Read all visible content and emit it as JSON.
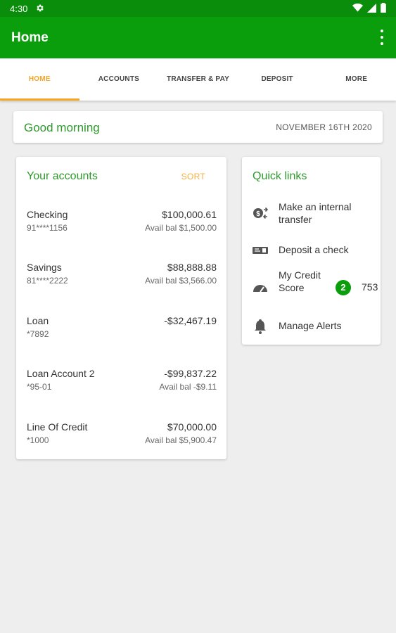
{
  "status_bar": {
    "time": "4:30",
    "icons": [
      "gear-icon",
      "wifi-icon",
      "signal-icon",
      "battery-icon"
    ]
  },
  "app_bar": {
    "title": "Home",
    "menu_icon": "more-vert-icon"
  },
  "tabs": [
    {
      "label": "HOME",
      "active": true
    },
    {
      "label": "ACCOUNTS",
      "active": false
    },
    {
      "label": "TRANSFER & PAY",
      "active": false
    },
    {
      "label": "DEPOSIT",
      "active": false
    },
    {
      "label": "MORE",
      "active": false
    }
  ],
  "greeting": {
    "text": "Good morning",
    "date": "NOVEMBER 16TH 2020"
  },
  "accounts": {
    "title": "Your accounts",
    "sort_label": "SORT",
    "items": [
      {
        "name": "Checking",
        "number": "91****1156",
        "amount": "$100,000.61",
        "avail": "Avail bal $1,500.00"
      },
      {
        "name": "Savings",
        "number": "81****2222",
        "amount": "$88,888.88",
        "avail": "Avail bal $3,566.00"
      },
      {
        "name": "Loan",
        "number": "*7892",
        "amount": "-$32,467.19",
        "avail": ""
      },
      {
        "name": "Loan Account 2",
        "number": "*95-01",
        "amount": "-$99,837.22",
        "avail": "Avail bal -$9.11"
      },
      {
        "name": "Line Of Credit",
        "number": "*1000",
        "amount": "$70,000.00",
        "avail": "Avail bal $5,900.47"
      }
    ]
  },
  "quick_links": {
    "title": "Quick links",
    "items": [
      {
        "label": "Make an internal transfer",
        "icon": "transfer-icon"
      },
      {
        "label": "Deposit a check",
        "icon": "check-deposit-icon"
      },
      {
        "label": "My Credit Score",
        "icon": "speedometer-icon",
        "badge": "2",
        "score": "753"
      },
      {
        "label": "Manage Alerts",
        "icon": "bell-icon"
      }
    ]
  },
  "colors": {
    "primary": "#0A9E0C",
    "status_bar": "#098D0A",
    "accent": "#F5A623",
    "heading_green": "#2E9A2C",
    "background": "#EEEEEE"
  }
}
